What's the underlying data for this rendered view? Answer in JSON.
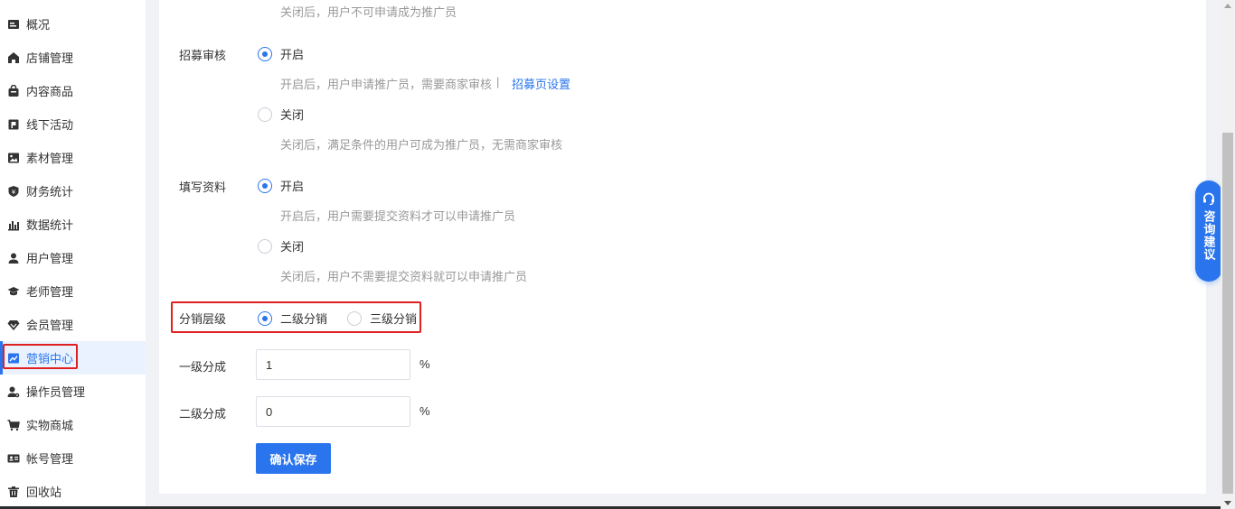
{
  "sidebar": {
    "items": [
      {
        "label": "概况",
        "icon": "overview-icon"
      },
      {
        "label": "店铺管理",
        "icon": "store-icon"
      },
      {
        "label": "内容商品",
        "icon": "bag-icon"
      },
      {
        "label": "线下活动",
        "icon": "flag-icon"
      },
      {
        "label": "素材管理",
        "icon": "image-icon"
      },
      {
        "label": "财务统计",
        "icon": "yen-shield-icon"
      },
      {
        "label": "数据统计",
        "icon": "bar-chart-icon"
      },
      {
        "label": "用户管理",
        "icon": "user-icon"
      },
      {
        "label": "老师管理",
        "icon": "graduation-cap-icon"
      },
      {
        "label": "会员管理",
        "icon": "diamond-icon"
      },
      {
        "label": "营销中心",
        "icon": "trend-chart-icon",
        "active": true
      },
      {
        "label": "操作员管理",
        "icon": "operator-icon"
      },
      {
        "label": "实物商城",
        "icon": "cart-icon"
      },
      {
        "label": "帐号管理",
        "icon": "id-card-icon"
      },
      {
        "label": "回收站",
        "icon": "trash-icon"
      }
    ]
  },
  "form": {
    "top_help": "关闭后，用户不可申请成为推广员",
    "recruit_review": {
      "label": "招募审核",
      "on_label": "开启",
      "on_help": "开启后，用户申请推广员，需要商家审核",
      "separator": "|",
      "link_label": "招募页设置",
      "off_label": "关闭",
      "off_help": "关闭后，满足条件的用户可成为推广员，无需商家审核",
      "selected": "on"
    },
    "fill_info": {
      "label": "填写资料",
      "on_label": "开启",
      "on_help": "开启后，用户需要提交资料才可以申请推广员",
      "off_label": "关闭",
      "off_help": "关闭后，用户不需要提交资料就可以申请推广员",
      "selected": "on"
    },
    "distribution_level": {
      "label": "分销层级",
      "option_two": "二级分销",
      "option_three": "三级分销",
      "selected": "two"
    },
    "level1_share": {
      "label": "一级分成",
      "value": "1",
      "unit": "%"
    },
    "level2_share": {
      "label": "二级分成",
      "value": "0",
      "unit": "%"
    },
    "save_label": "确认保存"
  },
  "consult": {
    "label": "咨询建议",
    "icon": "headset-icon"
  },
  "colors": {
    "accent": "#2a75ed",
    "highlight_box": "#e02020"
  }
}
